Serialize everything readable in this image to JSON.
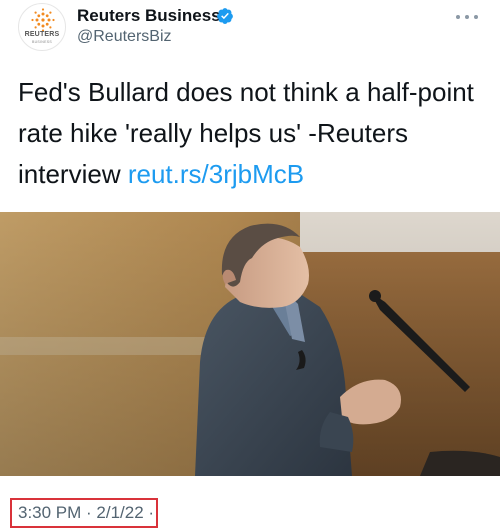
{
  "account": {
    "display_name": "Reuters Business",
    "handle": "@ReutersBiz",
    "avatar_wordmark": "REUTERS",
    "avatar_sub": "BUSINESS",
    "verified_icon": "verified-badge-icon",
    "more_icon": "more-options-icon"
  },
  "tweet": {
    "text": "Fed's Bullard does not think a half-point rate hike 'really helps us' -Reuters interview ",
    "link_text": "reut.rs/3rjbMcB",
    "timestamp": "3:30 PM · 2/1/22 ·"
  },
  "colors": {
    "link": "#1d9bf0",
    "verified": "#1d9bf0",
    "highlight_box": "#d9323a",
    "secondary_text": "#536471"
  }
}
